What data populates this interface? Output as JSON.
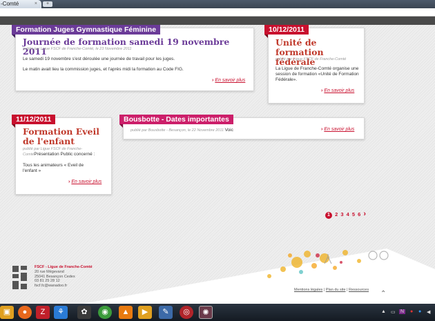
{
  "browser": {
    "tab_title": "-Comté",
    "tab_close": "×",
    "new_tab": "+"
  },
  "cards": {
    "c1": {
      "ribbon": "Formation Juges Gymnastique Féminine",
      "title": "Journée de formation samedi 19 novembre 2011",
      "meta": "publié par Ligue FSCF de Franche-Comté, le 23 Novembre 2011",
      "body1": "Le samedi 19 novembre s'est déroulée une journée de travail pour les juges.",
      "body2": "Le matin avait lieu la commission juges, et l'après midi la formation au Code FIG.",
      "more": "En savoir plus"
    },
    "c2": {
      "ribbon": "10/12/2011",
      "title": "Unité de formation fédérale",
      "meta": "publié par Ligue FSCF de Franche-Comté",
      "body": "La Ligue de Franche-Comté organise une session de formation «Unité de Formation Fédérale».",
      "more": "En savoir plus"
    },
    "c3": {
      "ribbon": "11/12/2011",
      "title": "Formation Eveil de l'enfant",
      "meta": "publié par Ligue FSCF de Franche-Comté",
      "meta_tail": "Présentation Public concerné :",
      "body": "Tous les animateurs « Eveil de l'enfant »",
      "more": "En savoir plus"
    },
    "c4": {
      "ribbon": "Bousbotte - Dates importantes",
      "meta": "publié par Bousbotte - Besançon, le 22 Novembre 2011",
      "meta_tail": "Voic",
      "more": "En savoir plus"
    }
  },
  "pagination": {
    "current": "1",
    "pages": [
      "2",
      "3",
      "4",
      "5",
      "6"
    ],
    "next": "›"
  },
  "footer": {
    "org": "FSCF - Ligue de Franche-Comté",
    "street": "20 rue Mégevand",
    "city": "25041 Besançon Cedex",
    "phone": "03 81 25 28 12",
    "email": "fscf.fc@wanadoo.fr",
    "link_legal": "Mentions légales",
    "link_sep": "|",
    "link_sitemap": "Plan du site",
    "link_resources": "Ressources",
    "up": "⌃"
  },
  "colors": {
    "purple": "#6b3b98",
    "red": "#c8102e",
    "pink": "#cc1f6a"
  }
}
